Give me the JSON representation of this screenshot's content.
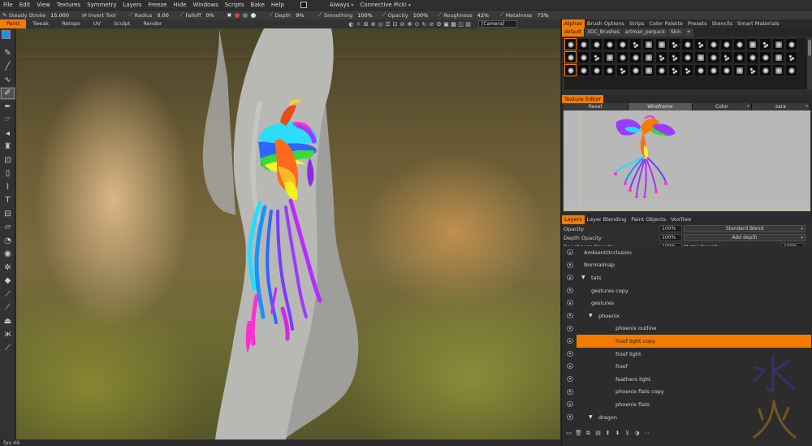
{
  "menu": {
    "items": [
      "File",
      "Edit",
      "View",
      "Textures",
      "Symmetry",
      "Layers",
      "Freeze",
      "Hide",
      "Windows",
      "Scripts",
      "Bake",
      "Help"
    ],
    "always_label": "Always",
    "connective_label": "Connective Picki"
  },
  "options": {
    "steady_stroke_label": "Steady Stroke",
    "steady_stroke_value": "15.000",
    "invert_tool_label": "Invert Tool",
    "radius_label": "Radius",
    "radius_value": "0.00",
    "falloff_label": "Falloff",
    "falloff_value": "0%",
    "depth_label": "Depth",
    "depth_value": "9%",
    "smoothing_label": "Smoothing",
    "smoothing_value": "100%",
    "opacity_label": "Opacity",
    "opacity_value": "100%",
    "roughness_label": "Roughness",
    "roughness_value": "42%",
    "metalness_label": "Metalness",
    "metalness_value": "73%",
    "color_swatches": [
      "#e53935",
      "#43a047",
      "#dddddd"
    ]
  },
  "rooms": {
    "items": [
      "Paint",
      "Tweak",
      "Retopo",
      "UV",
      "Sculpt",
      "Render"
    ],
    "active": "Paint"
  },
  "viewport": {
    "camera_value": "[Camera]",
    "fps": "fps:46"
  },
  "primary_color": "#1593ff",
  "secondary_color": "#ffffff",
  "accent_color": "#f57a00",
  "panel_tabs": [
    "Alphas",
    "Brush Options",
    "Strips",
    "Color Palette",
    "Presets",
    "Stencils",
    "Smart Materials"
  ],
  "alpha_subtabs": [
    "default",
    "3DC_Brushes",
    "artman_perpack",
    "Skin",
    "+"
  ],
  "texture_editor": {
    "title": "Texture Editor",
    "reset_label": "Reset",
    "wireframe_label": "Wireframe",
    "color_label": "Color",
    "object_value": "zara"
  },
  "layers_tabs": [
    "Layers",
    "Layer Blending",
    "Paint Objects",
    "VoxTree"
  ],
  "layer_props": {
    "opacity_label": "Opacity",
    "opacity_value": "100%",
    "blend_value": "Standard Blend",
    "depth_opacity_label": "Depth Opacity",
    "depth_opacity_value": "100%",
    "depth_blend_value": "Add depth",
    "roughness_opacity_label": "Roughness Opacity",
    "roughness_opacity_value": "100%",
    "metal_opacity_label": "Metal Opacity",
    "metal_opacity_value": "100%"
  },
  "layers": [
    {
      "name": "AmbientOcclusion",
      "indent": 0,
      "tri": false,
      "selected": false
    },
    {
      "name": "Normalmap",
      "indent": 0,
      "tri": false,
      "selected": false
    },
    {
      "name": "tats",
      "indent": 0,
      "tri": true,
      "selected": false
    },
    {
      "name": "gestures copy",
      "indent": 1,
      "tri": false,
      "selected": false
    },
    {
      "name": "gestures",
      "indent": 1,
      "tri": false,
      "selected": false
    },
    {
      "name": "phoenix",
      "indent": 1,
      "tri": true,
      "selected": false
    },
    {
      "name": "phoenix outline",
      "indent": 2,
      "tri": false,
      "selected": false
    },
    {
      "name": "froof light copy",
      "indent": 2,
      "tri": false,
      "selected": true
    },
    {
      "name": "froof light",
      "indent": 2,
      "tri": false,
      "selected": false
    },
    {
      "name": "froof",
      "indent": 2,
      "tri": false,
      "selected": false
    },
    {
      "name": "feathers light",
      "indent": 2,
      "tri": false,
      "selected": false
    },
    {
      "name": "phoenix flats copy",
      "indent": 2,
      "tri": false,
      "selected": false
    },
    {
      "name": "phoenix flats",
      "indent": 2,
      "tri": false,
      "selected": false
    },
    {
      "name": "dragon",
      "indent": 1,
      "tri": true,
      "selected": false
    }
  ]
}
